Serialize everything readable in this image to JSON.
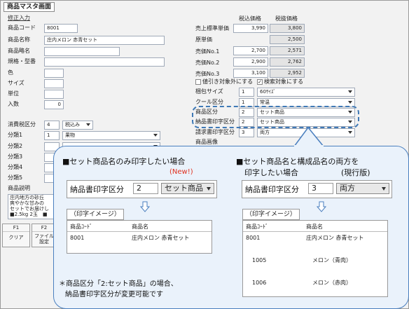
{
  "window": {
    "title": "商品マスタ画面"
  },
  "left": {
    "section_label": "修正入力",
    "fields": [
      {
        "label": "商品コード",
        "value": "8001"
      },
      {
        "label": "商品名称",
        "value": "庄内メロン 赤青セット"
      },
      {
        "label": "商品略名",
        "value": ""
      },
      {
        "label": "規格・型番",
        "value": ""
      },
      {
        "label": "色",
        "value": ""
      },
      {
        "label": "サイズ",
        "value": ""
      },
      {
        "label": "単位",
        "value": ""
      },
      {
        "label": "入数",
        "value": "0"
      }
    ],
    "tax": {
      "label": "消費税区分",
      "value": "4",
      "select": "税込み"
    },
    "classes": [
      {
        "label": "分類1",
        "value": "1",
        "select": "果物"
      },
      {
        "label": "分類2",
        "value": ""
      },
      {
        "label": "分類3",
        "value": ""
      },
      {
        "label": "分類4",
        "value": ""
      },
      {
        "label": "分類5",
        "value": ""
      }
    ],
    "desc_label": "商品説明",
    "desc_lines": [
      "庄内地方の砂丘",
      "爽やかな甘みの",
      "セットでお届けし",
      "■2.5kg 2玉　■"
    ],
    "fkeys": [
      {
        "key": "F1",
        "label": "クリア"
      },
      {
        "key": "F2",
        "label": "ファイル設定"
      }
    ]
  },
  "right": {
    "col_headers": [
      "税込価格",
      "税抜価格"
    ],
    "prices": [
      {
        "label": "売上標準単価",
        "incl": "3,990",
        "excl": "3,800"
      },
      {
        "label": "原単価",
        "incl": "",
        "excl": "2,500"
      },
      {
        "label": "売価No.1",
        "incl": "2,700",
        "excl": "2,571"
      },
      {
        "label": "売価No.2",
        "incl": "2,900",
        "excl": "2,762"
      },
      {
        "label": "売価No.3",
        "incl": "3,100",
        "excl": "2,952"
      }
    ],
    "checks": [
      {
        "label": "値引き対象外にする",
        "checked": false
      },
      {
        "label": "検索対象にする",
        "checked": true
      }
    ],
    "rows": [
      {
        "label": "梱包サイズ",
        "value": "1",
        "select": "60ｻｲｽﾞ"
      },
      {
        "label": "クール区分",
        "value": "1",
        "select": "常温"
      },
      {
        "label": "商品区分",
        "value": "2",
        "select": "セット商品"
      },
      {
        "label": "納品書印字区分",
        "value": "2",
        "select": "セット商品"
      },
      {
        "label": "請求書印字区分",
        "value": "3",
        "select": "両方"
      },
      {
        "label": "商品画像",
        "value": "",
        "select": ""
      }
    ]
  },
  "callout": {
    "left": {
      "heading": "■セット商品名のみ印字したい場合",
      "note": "(New!)",
      "field_label": "納品書印字区分",
      "field_value": "2",
      "field_select": "セット商品",
      "image_label": "（印字イメージ）",
      "table_headers": [
        "商品ｺｰﾄﾞ",
        "商品名"
      ],
      "rows": [
        {
          "code": "8001",
          "name": "庄内メロン 赤青セット"
        }
      ]
    },
    "right": {
      "heading_line1": "■セット商品名と構成品名の両方を",
      "heading_line2": "印字したい場合",
      "note": "(現行版)",
      "field_label": "納品書印字区分",
      "field_value": "3",
      "field_select": "両方",
      "image_label": "（印字イメージ）",
      "table_headers": [
        "商品ｺｰﾄﾞ",
        "商品名"
      ],
      "rows": [
        {
          "code": "8001",
          "name": "庄内メロン 赤青セット"
        },
        {
          "code": "1005",
          "name": "メロン（青肉）"
        },
        {
          "code": "1006",
          "name": "メロン（赤肉）"
        }
      ]
    },
    "footnote_line1": "＊商品区分「2:セット商品」の場合、",
    "footnote_line2": "納品書印字区分が変更可能です"
  },
  "colors": {
    "accent_blue": "#3f79b6",
    "note_red": "#e0301e",
    "callout_bg": "#eaf2fb"
  }
}
